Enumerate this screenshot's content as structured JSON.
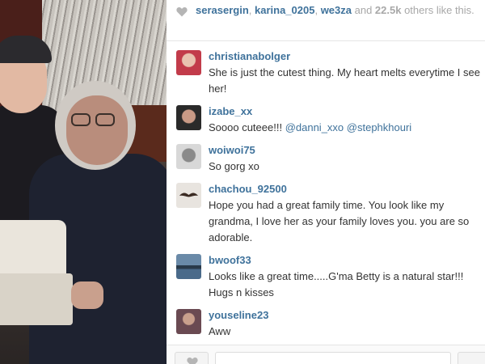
{
  "likes": {
    "users": [
      "serasergin",
      "karina_0205",
      "we3za"
    ],
    "separator": ", ",
    "and_text": " and ",
    "count": "22.5k",
    "suffix": " others like this."
  },
  "comments": [
    {
      "user": "christianabolger",
      "text": "She is just the cutest thing. My heart melts everytime I see her!",
      "avatar_color": "#c23b4a"
    },
    {
      "user": "izabe_xx",
      "text_before": "Soooo cuteee!!! ",
      "mention1": "@danni_xxo",
      "text_mid": " ",
      "mention2": "@stephkhouri",
      "avatar_color": "#2a2a2a"
    },
    {
      "user": "woiwoi75",
      "text": "So gorg xo",
      "avatar_color": "#d8d8d8"
    },
    {
      "user": "chachou_92500",
      "text": "Hope you had a great family time. You look like my grandma, I love her as your family loves you. you are so adorable.",
      "avatar_color": "#e8e4df"
    },
    {
      "user": "bwoof33",
      "text": "Looks like a great time.....G'ma Betty is a natural star!!! Hugs n kisses",
      "avatar_color": "#4a6a8a"
    },
    {
      "user": "youseline23",
      "text": "Aww",
      "avatar_color": "#6a4a52"
    }
  ],
  "footer": {
    "comment_placeholder": ""
  },
  "colors": {
    "link_blue": "#3f729b",
    "muted_gray": "#a8a8a8",
    "heart_gray": "#b5b5b5"
  }
}
